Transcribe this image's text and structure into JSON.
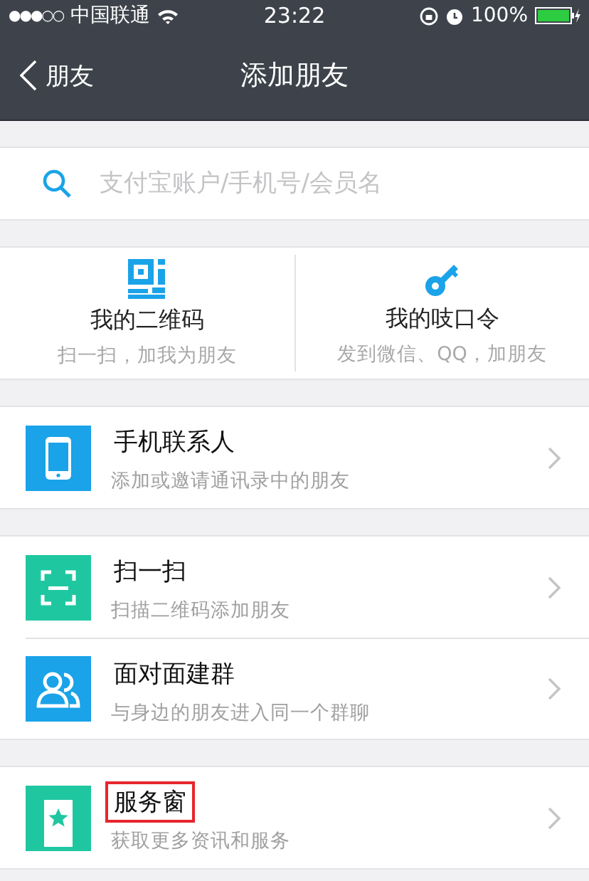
{
  "status_bar": {
    "signal": "●●●○○",
    "carrier": "中国联通",
    "time": "23:22",
    "battery": "100%"
  },
  "nav": {
    "back": "朋友",
    "title": "添加朋友"
  },
  "search": {
    "placeholder": "支付宝账户/手机号/会员名"
  },
  "cards": [
    {
      "kind": "qr",
      "title": "我的二维码",
      "subtitle": "扫一扫，加我为朋友"
    },
    {
      "kind": "key",
      "title": "我的吱口令",
      "subtitle": "发到微信、QQ，加朋友"
    }
  ],
  "groups": [
    [
      {
        "kind": "phone",
        "title": "手机联系人",
        "subtitle": "添加或邀请通讯录中的朋友",
        "color": "#1aa3e8",
        "highlighted": false
      }
    ],
    [
      {
        "kind": "scan",
        "title": "扫一扫",
        "subtitle": "扫描二维码添加朋友",
        "color": "#1fc7a1",
        "highlighted": false
      },
      {
        "kind": "people",
        "title": "面对面建群",
        "subtitle": "与身边的朋友进入同一个群聊",
        "color": "#1aa3e8",
        "highlighted": false
      }
    ],
    [
      {
        "kind": "star",
        "title": "服务窗",
        "subtitle": "获取更多资讯和服务",
        "color": "#1fc7a1",
        "highlighted": true
      }
    ]
  ]
}
